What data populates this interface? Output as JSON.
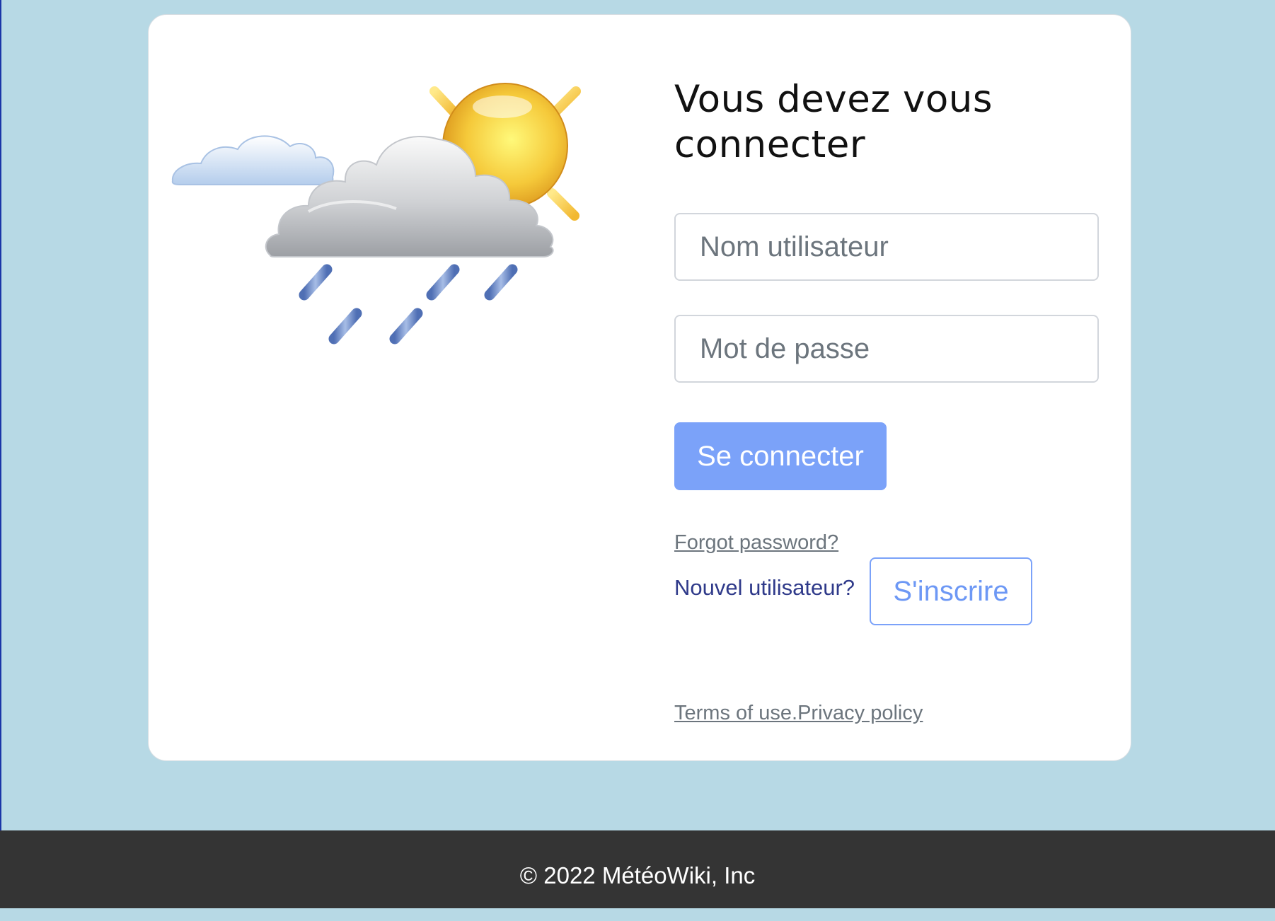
{
  "login": {
    "title": "Vous devez vous connecter",
    "username_placeholder": "Nom utilisateur",
    "password_placeholder": "Mot de passe",
    "login_button": "Se connecter",
    "forgot_password": "Forgot password?",
    "new_user_label": "Nouvel utilisateur?",
    "signup_button": "S'inscrire",
    "terms_link": "Terms of use.",
    "privacy_link": "Privacy policy"
  },
  "footer": {
    "copyright": "© 2022 MétéoWiki, Inc"
  },
  "illustration": {
    "icon": "sun-cloud-rain-icon"
  },
  "colors": {
    "page_background": "#b7d9e5",
    "card": "#ffffff",
    "primary_button": "#7ba2f9",
    "footer": "#343434"
  }
}
